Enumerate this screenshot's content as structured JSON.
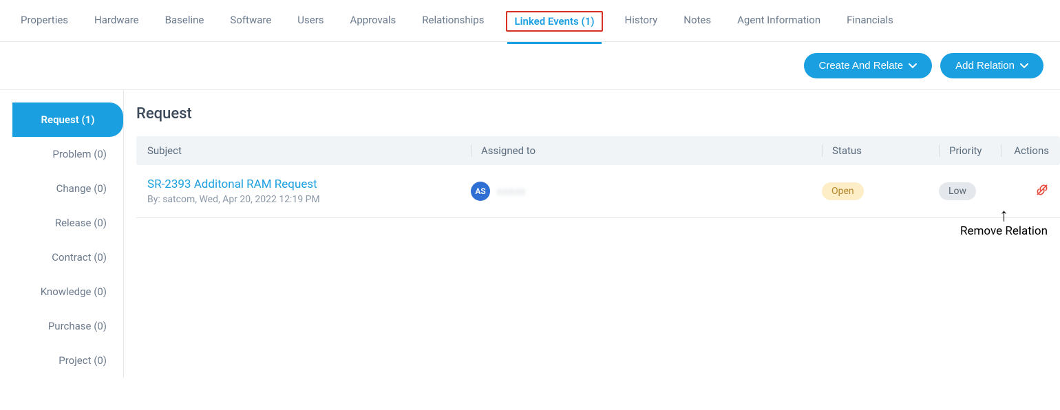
{
  "tabs": {
    "properties": "Properties",
    "hardware": "Hardware",
    "baseline": "Baseline",
    "software": "Software",
    "users": "Users",
    "approvals": "Approvals",
    "relationships": "Relationships",
    "linked_events": "Linked Events (1)",
    "history": "History",
    "notes": "Notes",
    "agent_information": "Agent Information",
    "financials": "Financials"
  },
  "actions": {
    "create_relate": "Create And Relate",
    "add_relation": "Add Relation"
  },
  "side": {
    "request": "Request (1)",
    "problem": "Problem (0)",
    "change": "Change (0)",
    "release": "Release (0)",
    "contract": "Contract (0)",
    "knowledge": "Knowledge (0)",
    "purchase": "Purchase (0)",
    "project": "Project (0)"
  },
  "main": {
    "heading": "Request",
    "columns": {
      "subject": "Subject",
      "assigned_to": "Assigned to",
      "status": "Status",
      "priority": "Priority",
      "actions": "Actions"
    },
    "row": {
      "title": "SR-2393 Additonal RAM Request",
      "by": "By: satcom, Wed, Apr 20, 2022 12:19 PM",
      "avatar": "AS",
      "assignee_masked": "xxxxx",
      "status": "Open",
      "priority": "Low"
    }
  },
  "annotation": {
    "arrow": "↑",
    "label": "Remove Relation"
  }
}
